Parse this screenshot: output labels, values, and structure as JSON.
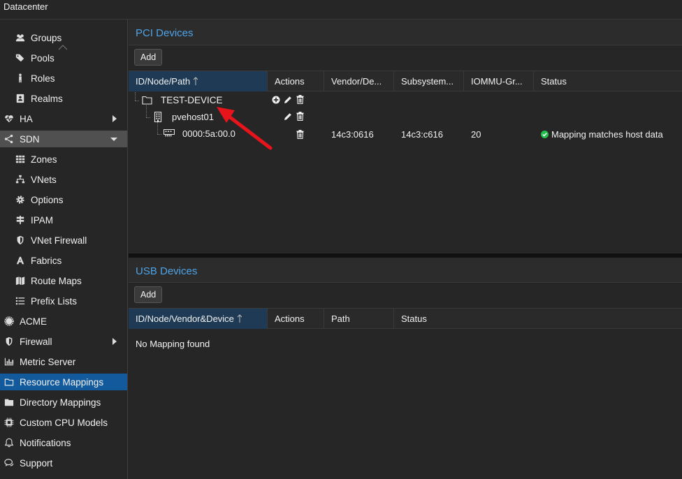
{
  "topbar": {
    "title": "Datacenter"
  },
  "sidebar": {
    "items": [
      {
        "label": "Groups",
        "icon": "users-icon",
        "level": 2
      },
      {
        "label": "Pools",
        "icon": "tags-icon",
        "level": 2
      },
      {
        "label": "Roles",
        "icon": "male-icon",
        "level": 2
      },
      {
        "label": "Realms",
        "icon": "address-book-icon",
        "level": 2
      },
      {
        "label": "HA",
        "icon": "heartbeat-icon",
        "level": 1,
        "expander": "right"
      },
      {
        "label": "SDN",
        "icon": "sdn-icon",
        "level": 1,
        "expander": "down"
      },
      {
        "label": "Zones",
        "icon": "grid-icon",
        "level": 2
      },
      {
        "label": "VNets",
        "icon": "network-icon",
        "level": 2
      },
      {
        "label": "Options",
        "icon": "gear-icon",
        "level": 2
      },
      {
        "label": "IPAM",
        "icon": "signpost-icon",
        "level": 2
      },
      {
        "label": "VNet Firewall",
        "icon": "shield-icon",
        "level": 2
      },
      {
        "label": "Fabrics",
        "icon": "fabric-icon",
        "level": 2
      },
      {
        "label": "Route Maps",
        "icon": "map-icon",
        "level": 2
      },
      {
        "label": "Prefix Lists",
        "icon": "list-icon",
        "level": 2
      },
      {
        "label": "ACME",
        "icon": "certificate-icon",
        "level": 1
      },
      {
        "label": "Firewall",
        "icon": "shield-icon",
        "level": 1,
        "expander": "right"
      },
      {
        "label": "Metric Server",
        "icon": "bar-chart-icon",
        "level": 1
      },
      {
        "label": "Resource Mappings",
        "icon": "folder-outline-icon",
        "level": 1,
        "selected": true
      },
      {
        "label": "Directory Mappings",
        "icon": "folder-icon",
        "level": 1
      },
      {
        "label": "Custom CPU Models",
        "icon": "cpu-icon",
        "level": 1
      },
      {
        "label": "Notifications",
        "icon": "bell-icon",
        "level": 1
      },
      {
        "label": "Support",
        "icon": "comments-icon",
        "level": 1
      }
    ]
  },
  "pci": {
    "title": "PCI Devices",
    "add_label": "Add",
    "columns": [
      "ID/Node/Path",
      "Actions",
      "Vendor/De...",
      "Subsystem...",
      "IOMMU-Gr...",
      "Status"
    ],
    "rows": {
      "device": {
        "label": "TEST-DEVICE"
      },
      "node": {
        "label": "pvehost01"
      },
      "path": {
        "label": "0000:5a:00.0",
        "vendor": "14c3:0616",
        "subsystem": "14c3:c616",
        "iommu": "20",
        "status": "Mapping matches host data"
      }
    }
  },
  "usb": {
    "title": "USB Devices",
    "add_label": "Add",
    "columns": [
      "ID/Node/Vendor&Device",
      "Actions",
      "Path",
      "Status"
    ],
    "empty_text": "No Mapping found"
  },
  "colors": {
    "accent": "#4fa4e8",
    "selected": "#135a9c",
    "ok": "#21bf4b",
    "annotation": "#e8141c"
  }
}
